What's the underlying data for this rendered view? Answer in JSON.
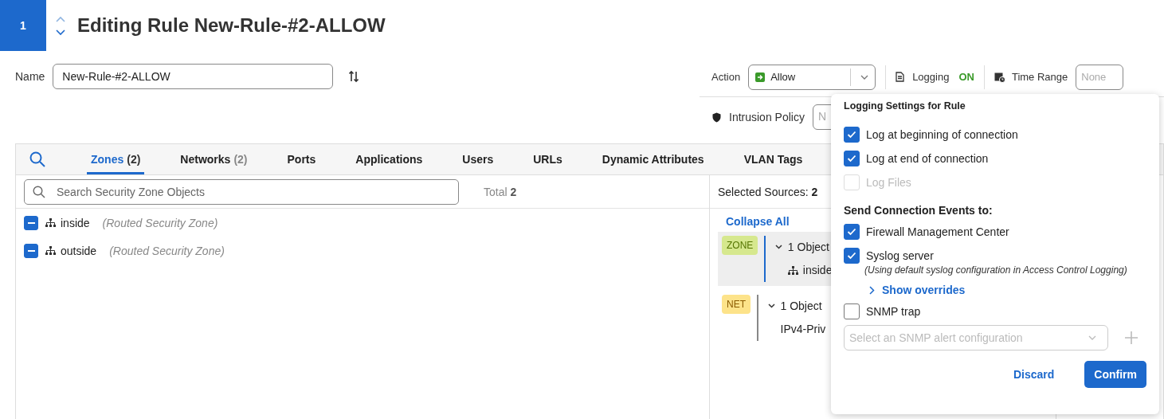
{
  "header": {
    "index": "1",
    "title": "Editing Rule New-Rule-#2-ALLOW"
  },
  "name_field": {
    "label": "Name",
    "value": "New-Rule-#2-ALLOW"
  },
  "action": {
    "label": "Action",
    "value": "Allow"
  },
  "logging": {
    "label": "Logging",
    "status": "ON"
  },
  "time_range": {
    "label": "Time Range",
    "placeholder": "None"
  },
  "intrusion_policy": {
    "label": "Intrusion Policy",
    "placeholder": "N"
  },
  "tabs": [
    {
      "label": "Zones",
      "count": "(2)",
      "selected": true
    },
    {
      "label": "Networks",
      "count": "(2)",
      "selected": false
    },
    {
      "label": "Ports",
      "selected": false
    },
    {
      "label": "Applications",
      "selected": false
    },
    {
      "label": "Users",
      "selected": false
    },
    {
      "label": "URLs",
      "selected": false
    },
    {
      "label": "Dynamic Attributes",
      "selected": false
    },
    {
      "label": "VLAN Tags",
      "selected": false
    }
  ],
  "zone_search": {
    "placeholder": "Search Security Zone Objects",
    "total_label": "Total",
    "total": "2"
  },
  "zones": [
    {
      "name": "inside",
      "type": "(Routed Security Zone)",
      "checked": true
    },
    {
      "name": "outside",
      "type": "(Routed Security Zone)",
      "checked": true
    }
  ],
  "selected_sources": {
    "label": "Selected Sources:",
    "count": "2",
    "collapse": "Collapse All",
    "groups": [
      {
        "tag": "ZONE",
        "kind": "zone",
        "color": "#d6e88e",
        "highlighted": true,
        "summary": "1 Object",
        "item": "inside"
      },
      {
        "tag": "NET",
        "kind": "network",
        "color": "#fde38a",
        "highlighted": false,
        "summary": "1 Object",
        "item": "IPv4-Priv"
      }
    ]
  },
  "logging_popup": {
    "title": "Logging Settings for Rule",
    "log_options": [
      {
        "label": "Log at beginning of connection",
        "checked": true,
        "disabled": false
      },
      {
        "label": "Log at end of connection",
        "checked": true,
        "disabled": false
      },
      {
        "label": "Log Files",
        "checked": false,
        "disabled": true
      }
    ],
    "events_heading": "Send Connection Events to:",
    "destinations": [
      {
        "label": "Firewall Management Center",
        "checked": true
      },
      {
        "label": "Syslog server",
        "checked": true,
        "note": "(Using default syslog configuration in Access Control Logging)",
        "link": "Show overrides"
      },
      {
        "label": "SNMP trap",
        "checked": false,
        "select_placeholder": "Select an SNMP alert configuration"
      }
    ],
    "buttons": [
      {
        "label": "Discard",
        "kind": "secondary"
      },
      {
        "label": "Confirm",
        "kind": "primary"
      }
    ]
  }
}
